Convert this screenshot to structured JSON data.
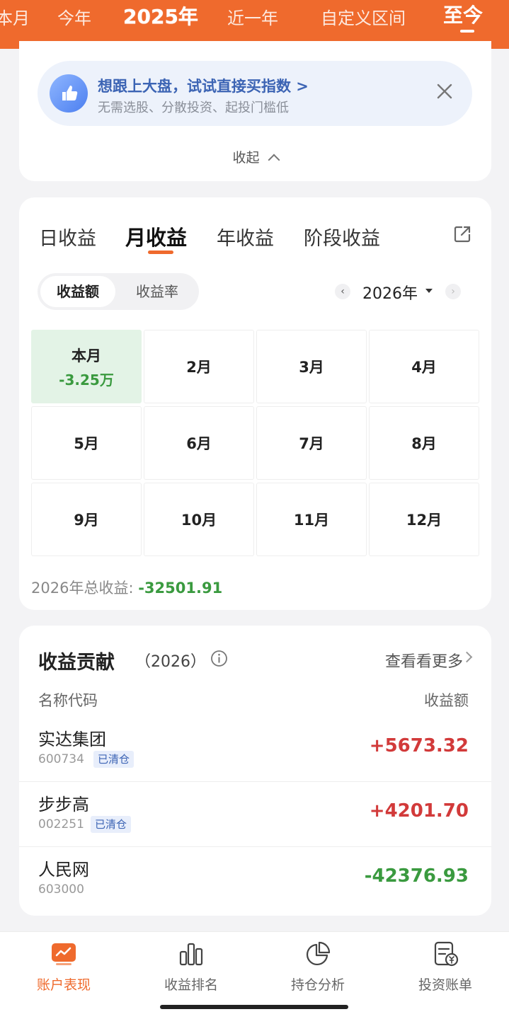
{
  "header": {
    "periods": [
      "本月",
      "今年",
      "2025年",
      "近一年",
      "自定义区间",
      "至今"
    ],
    "active_period": "至今",
    "accent": "#ef6a2d"
  },
  "promo": {
    "title": "想跟上大盘，试试直接买指数 >",
    "subtitle": "无需选股、分散投资、起投门槛低",
    "icon": "thumbs-up-icon",
    "collapse_label": "收起"
  },
  "earnings": {
    "tabs": [
      "日收益",
      "月收益",
      "年收益",
      "阶段收益"
    ],
    "active_tab": "月收益",
    "segment": {
      "amount": "收益额",
      "rate": "收益率"
    },
    "year": "2026年",
    "months": [
      {
        "label": "本月",
        "value": "-3.25万"
      },
      {
        "label": "2月"
      },
      {
        "label": "3月"
      },
      {
        "label": "4月"
      },
      {
        "label": "5月"
      },
      {
        "label": "6月"
      },
      {
        "label": "7月"
      },
      {
        "label": "8月"
      },
      {
        "label": "9月"
      },
      {
        "label": "10月"
      },
      {
        "label": "11月"
      },
      {
        "label": "12月"
      }
    ],
    "total_label": "2026年总收益: ",
    "total_value": "-32501.91"
  },
  "contribution": {
    "title": "收益贡献",
    "year": "（2026）",
    "more": "查看看更多",
    "col_name": "名称代码",
    "col_amount": "收益额",
    "rows": [
      {
        "name": "实达集团",
        "code": "600734",
        "badge": "已清仓",
        "amount": "+5673.32"
      },
      {
        "name": "步步高",
        "code": "002251",
        "badge": "已清仓",
        "amount": "+4201.70"
      },
      {
        "name": "人民网",
        "code": "603000",
        "badge": "",
        "amount": "-42376.93"
      }
    ]
  },
  "bottom_nav": [
    {
      "label": "账户表现",
      "icon": "account-chart-icon"
    },
    {
      "label": "收益排名",
      "icon": "bar-ranking-icon"
    },
    {
      "label": "持仓分析",
      "icon": "pie-chart-icon"
    },
    {
      "label": "投资账单",
      "icon": "bill-icon"
    }
  ]
}
